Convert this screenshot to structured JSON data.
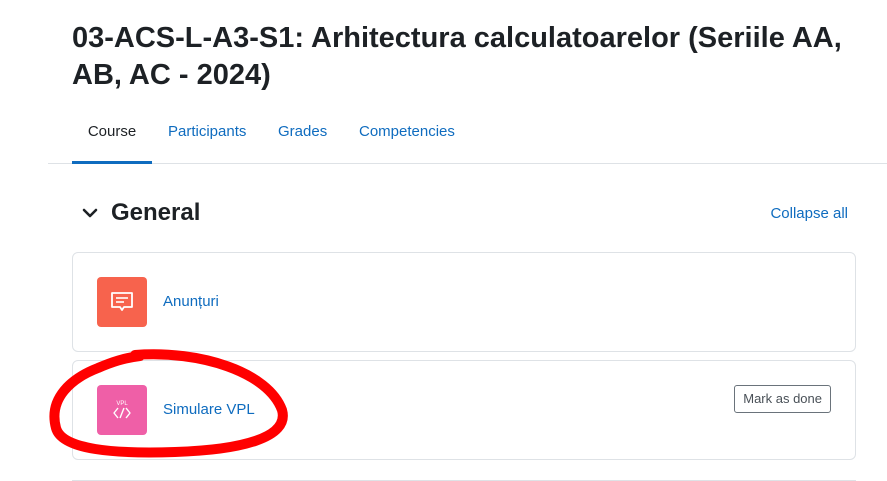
{
  "course": {
    "title": "03-ACS-L-A3-S1: Arhitectura calculatoarelor (Seriile AA, AB, AC - 2024)"
  },
  "tabs": [
    {
      "label": "Course",
      "active": true
    },
    {
      "label": "Participants",
      "active": false
    },
    {
      "label": "Grades",
      "active": false
    },
    {
      "label": "Competencies",
      "active": false
    }
  ],
  "section": {
    "title": "General",
    "collapse_all_label": "Collapse all",
    "toggle_icon": "chevron-down-icon"
  },
  "activities": [
    {
      "name": "Anunțuri",
      "icon": "forum-icon",
      "icon_color": "#f7634d"
    },
    {
      "name": "Simulare VPL",
      "icon": "vpl-icon",
      "icon_label": "VPL",
      "icon_color": "#ef5fa7",
      "completion_button": "Mark as done"
    }
  ],
  "colors": {
    "link": "#0f6cbf",
    "annotation_stroke": "#ff0000"
  }
}
